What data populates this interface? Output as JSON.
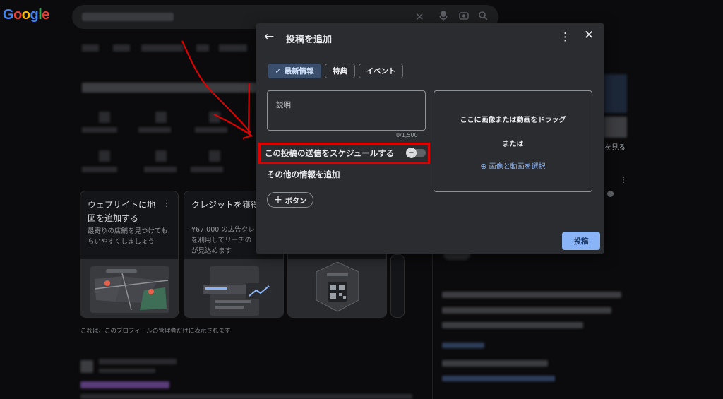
{
  "logo": "Google",
  "colors": {
    "accent": "#8ab4f8",
    "highlight_box": "#e00000",
    "dialog_bg": "#2b2c2f",
    "page_bg": "#0b0b0d",
    "logo_letters": [
      "#4285f4",
      "#ea4335",
      "#fbbc05",
      "#4285f4",
      "#34a853",
      "#ea4335"
    ]
  },
  "search": {
    "icons": [
      "close-icon",
      "mic-icon",
      "camera-icon",
      "search-icon"
    ]
  },
  "background_cards": [
    {
      "title_line1": "ウェブサイトに地",
      "title_line2": "図を追加する",
      "desc_line1": "最寄りの店舗を見つけても",
      "desc_line2": "らいやすくしましょう"
    },
    {
      "title_line1": "クレジットを獲得",
      "desc_line1": "¥67,000 の広告クレ",
      "desc_line2": "を利用してリーチの",
      "desc_line3": "が見込めます"
    }
  ],
  "partial_right_text": "を見る",
  "admin_note": "これは、このプロフィールの管理者だけに表示されます",
  "dialog": {
    "back_icon": "arrow-back-icon",
    "title": "投稿を追加",
    "more_icon": "more-vert-icon",
    "close_icon": "close-icon",
    "chips": [
      {
        "label": "最新情報",
        "selected": true
      },
      {
        "label": "特典",
        "selected": false
      },
      {
        "label": "イベント",
        "selected": false
      }
    ],
    "description_placeholder": "説明",
    "char_counter": "0/1,500",
    "schedule_label": "この投稿の送信をスケジュールする",
    "schedule_enabled": false,
    "more_info_label": "その他の情報を追加",
    "add_button_label": "ボタン",
    "dropzone": {
      "line1": "ここに画像または動画をドラッグ",
      "line2": "または",
      "select_link": "画像と動画を選択"
    },
    "post_button": "投稿"
  }
}
